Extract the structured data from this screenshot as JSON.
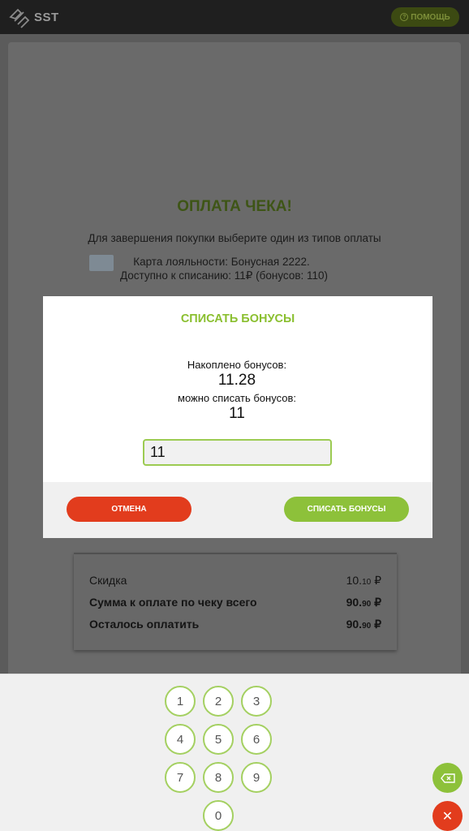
{
  "header": {
    "logo_text": "SST",
    "help_label": "ПОМОЩЬ",
    "help_icon": "question-icon"
  },
  "payment": {
    "title": "ОПЛАТА ЧЕКА!",
    "subtitle": "Для завершения покупки выберите один из типов оплаты",
    "loyalty_line1": "Карта лояльности: Бонусная 2222.",
    "loyalty_line2": "Доступно к списанию: 11₽ (бонусов: 110)"
  },
  "summary": {
    "rows": [
      {
        "label": "Скидка",
        "amount_main": "10.",
        "amount_cents": "10",
        "currency": " ₽"
      },
      {
        "label": "Сумма к оплате по чеку всего",
        "amount_main": "90.",
        "amount_cents": "90",
        "currency": " ₽"
      },
      {
        "label": "Осталось оплатить",
        "amount_main": "90.",
        "amount_cents": "90",
        "currency": " ₽"
      }
    ]
  },
  "modal": {
    "title": "СПИСАТЬ БОНУСЫ",
    "accumulated_label": "Накоплено бонусов:",
    "accumulated_value": "11.28",
    "can_write_off_label": "можно списать бонусов:",
    "can_write_off_value": "11",
    "input_value": "11",
    "cancel_label": "ОТМЕНА",
    "confirm_label": "СПИСАТЬ БОНУСЫ"
  },
  "keypad": {
    "keys": [
      "1",
      "2",
      "3",
      "4",
      "5",
      "6",
      "7",
      "8",
      "9",
      "0"
    ],
    "backspace_icon": "backspace-icon",
    "close_icon": "close-icon",
    "close_glyph": "✕"
  },
  "colors": {
    "accent_green": "#8dc13a",
    "danger_red": "#e23c1d",
    "topbar": "#1f1f1f"
  }
}
